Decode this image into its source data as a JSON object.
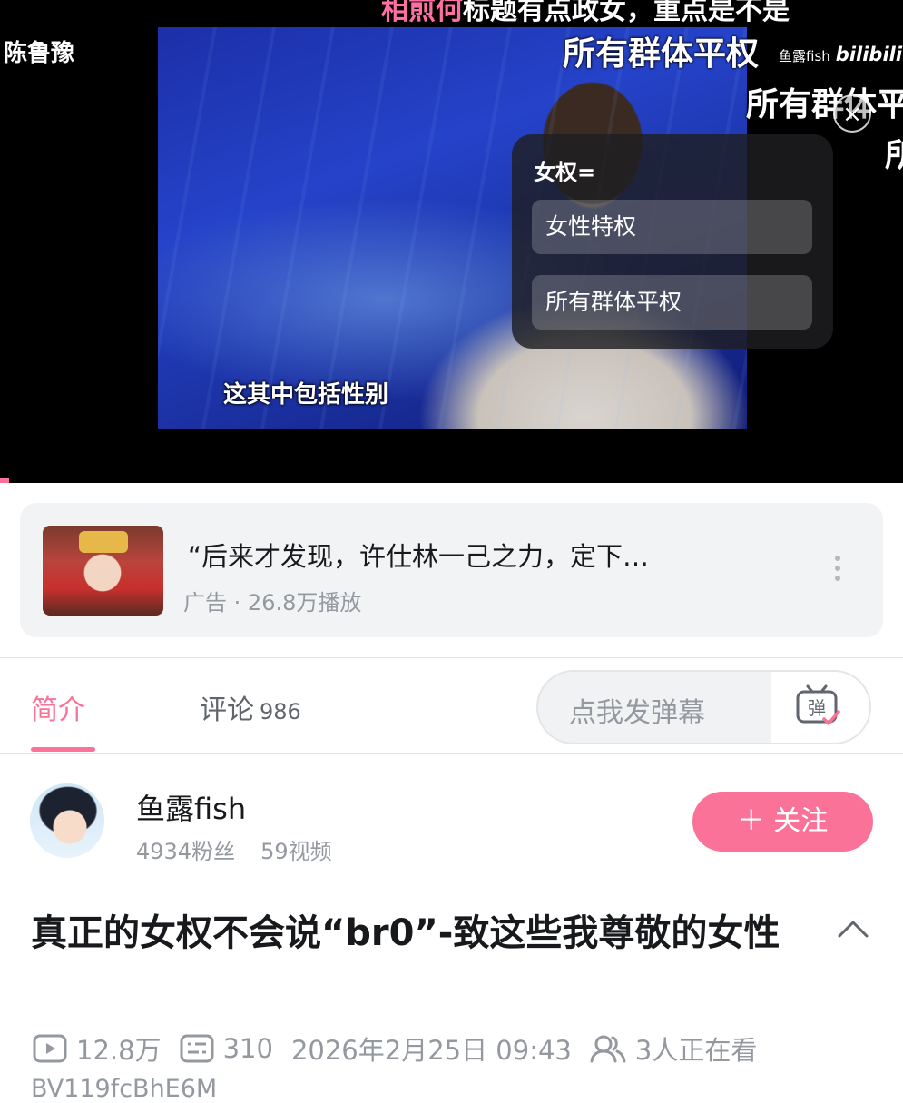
{
  "player": {
    "channel_name": "陈鲁豫",
    "top_danmaku_highlight": "相煎何",
    "top_danmaku_text": "标题有点政女，重点是不是",
    "danmaku": [
      "所有群体平权",
      "所有群体平",
      "所"
    ],
    "watermark_user": "鱼露fish",
    "watermark_brand": "bilibili",
    "subtitle": "这其中包括性别",
    "poll": {
      "question": "女权=",
      "options": [
        "女性特权",
        "所有群体平权"
      ]
    },
    "progress_fraction": 0.01,
    "accent_color": "#fb7299"
  },
  "ad": {
    "title": "“后来才发现，许仕林一己之力，定下…",
    "label": "广告",
    "separator": "·",
    "plays": "26.8万播放"
  },
  "tabs": {
    "intro": "简介",
    "comments": "评论",
    "comments_count": "986",
    "danmaku_placeholder": "点我发弹幕",
    "danmaku_icon_char": "弹"
  },
  "uploader": {
    "name": "鱼露fish",
    "fans": "4934粉丝",
    "videos": "59视频",
    "follow_label": "＋ 关注"
  },
  "video": {
    "title": "真正的女权不会说“br0”-致这些我尊敬的女性",
    "views": "12.8万",
    "danmaku_count": "310",
    "publish_time": "2026年2月25日 09:43",
    "watching": "3人正在看",
    "bvid": "BV119fcBhE6M"
  }
}
